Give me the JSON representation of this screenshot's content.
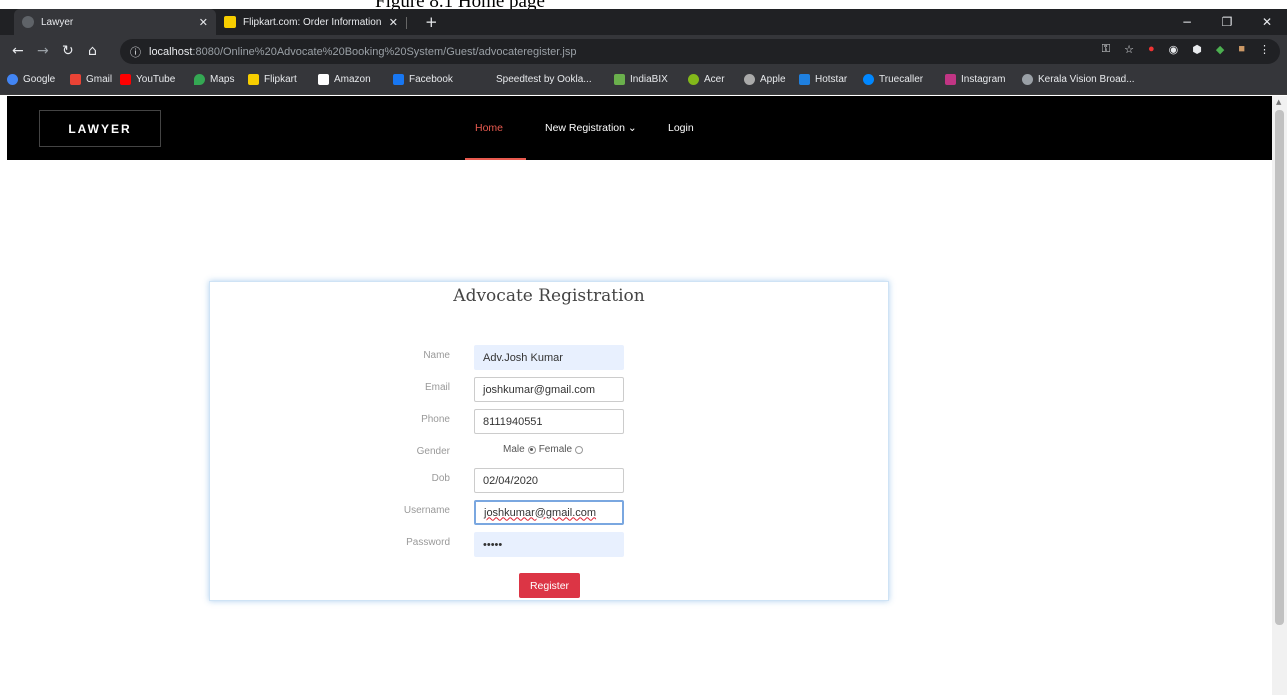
{
  "caption": "Figure 8.1 Home page",
  "browser": {
    "tabs": [
      {
        "title": "Lawyer",
        "active": true
      },
      {
        "title": "Flipkart.com: Order Information",
        "active": false
      }
    ],
    "new_tab": "+",
    "window_buttons": [
      "−",
      "❐",
      "✕"
    ],
    "url_host": "localhost",
    "url_rest": ":8080/Online%20Advocate%20Booking%20System/Guest/advocateregister.jsp",
    "bookmarks": [
      "Google",
      "Gmail",
      "YouTube",
      "Maps",
      "Flipkart",
      "Amazon",
      "Facebook",
      "Speedtest by Ookla...",
      "IndiaBIX",
      "Acer",
      "Apple",
      "Hotstar",
      "Truecaller",
      "Instagram",
      "Kerala Vision Broad..."
    ]
  },
  "site": {
    "logo": "LAWYER",
    "nav": {
      "home": "Home",
      "new_registration": "New Registration ⌄",
      "login": "Login"
    },
    "accent_color": "#e85a4f"
  },
  "form": {
    "title": "Advocate Registration",
    "fields": {
      "name": {
        "label": "Name",
        "value": "Adv.Josh Kumar"
      },
      "email": {
        "label": "Email",
        "value": "joshkumar@gmail.com"
      },
      "phone": {
        "label": "Phone",
        "value": "8111940551"
      },
      "gender": {
        "label": "Gender",
        "options": [
          "Male",
          "Female"
        ],
        "selected": "Male"
      },
      "dob": {
        "label": "Dob",
        "value": "02/04/2020"
      },
      "username": {
        "label": "Username",
        "value": "joshkumar@gmail.com"
      },
      "password": {
        "label": "Password",
        "value": "•••••"
      }
    },
    "submit_label": "Register",
    "submit_color": "#dc3545"
  }
}
